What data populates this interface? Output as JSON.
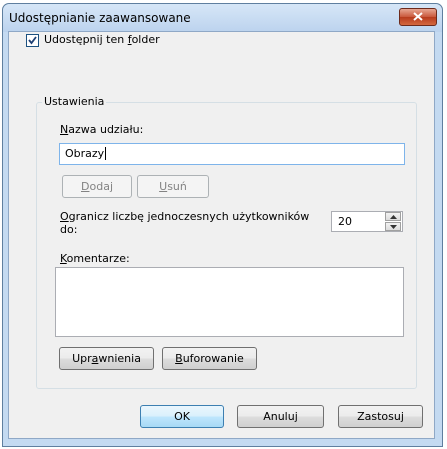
{
  "window": {
    "title": "Udostępnianie zaawansowane"
  },
  "share_checkbox": {
    "checked": true,
    "label_pre": "Udostępnij ten ",
    "label_u": "f",
    "label_post": "older"
  },
  "settings": {
    "legend": "Ustawienia",
    "share_name_label_u": "N",
    "share_name_label_post": "azwa udziału:",
    "share_name_value": "Obrazy",
    "add_u": "D",
    "add_post": "odaj",
    "remove_u": "U",
    "remove_post": "suń",
    "limit_label_u": "O",
    "limit_label_post": "granicz liczbę jednoczesnych użytkowników",
    "limit_label_line2": "do:",
    "limit_value": "20",
    "comments_label_u": "K",
    "comments_label_post": "omentarze:",
    "comments_value": "",
    "permissions_pre": "Upr",
    "permissions_u": "a",
    "permissions_post": "wnienia",
    "caching_u": "B",
    "caching_post": "uforowanie"
  },
  "footer": {
    "ok_label": "OK",
    "cancel_label": "Anuluj",
    "apply_label": "Zastosuj"
  },
  "colors": {
    "frame": "#c4daf1",
    "close": "#c9573a",
    "focus_border": "#7eb4ea"
  }
}
